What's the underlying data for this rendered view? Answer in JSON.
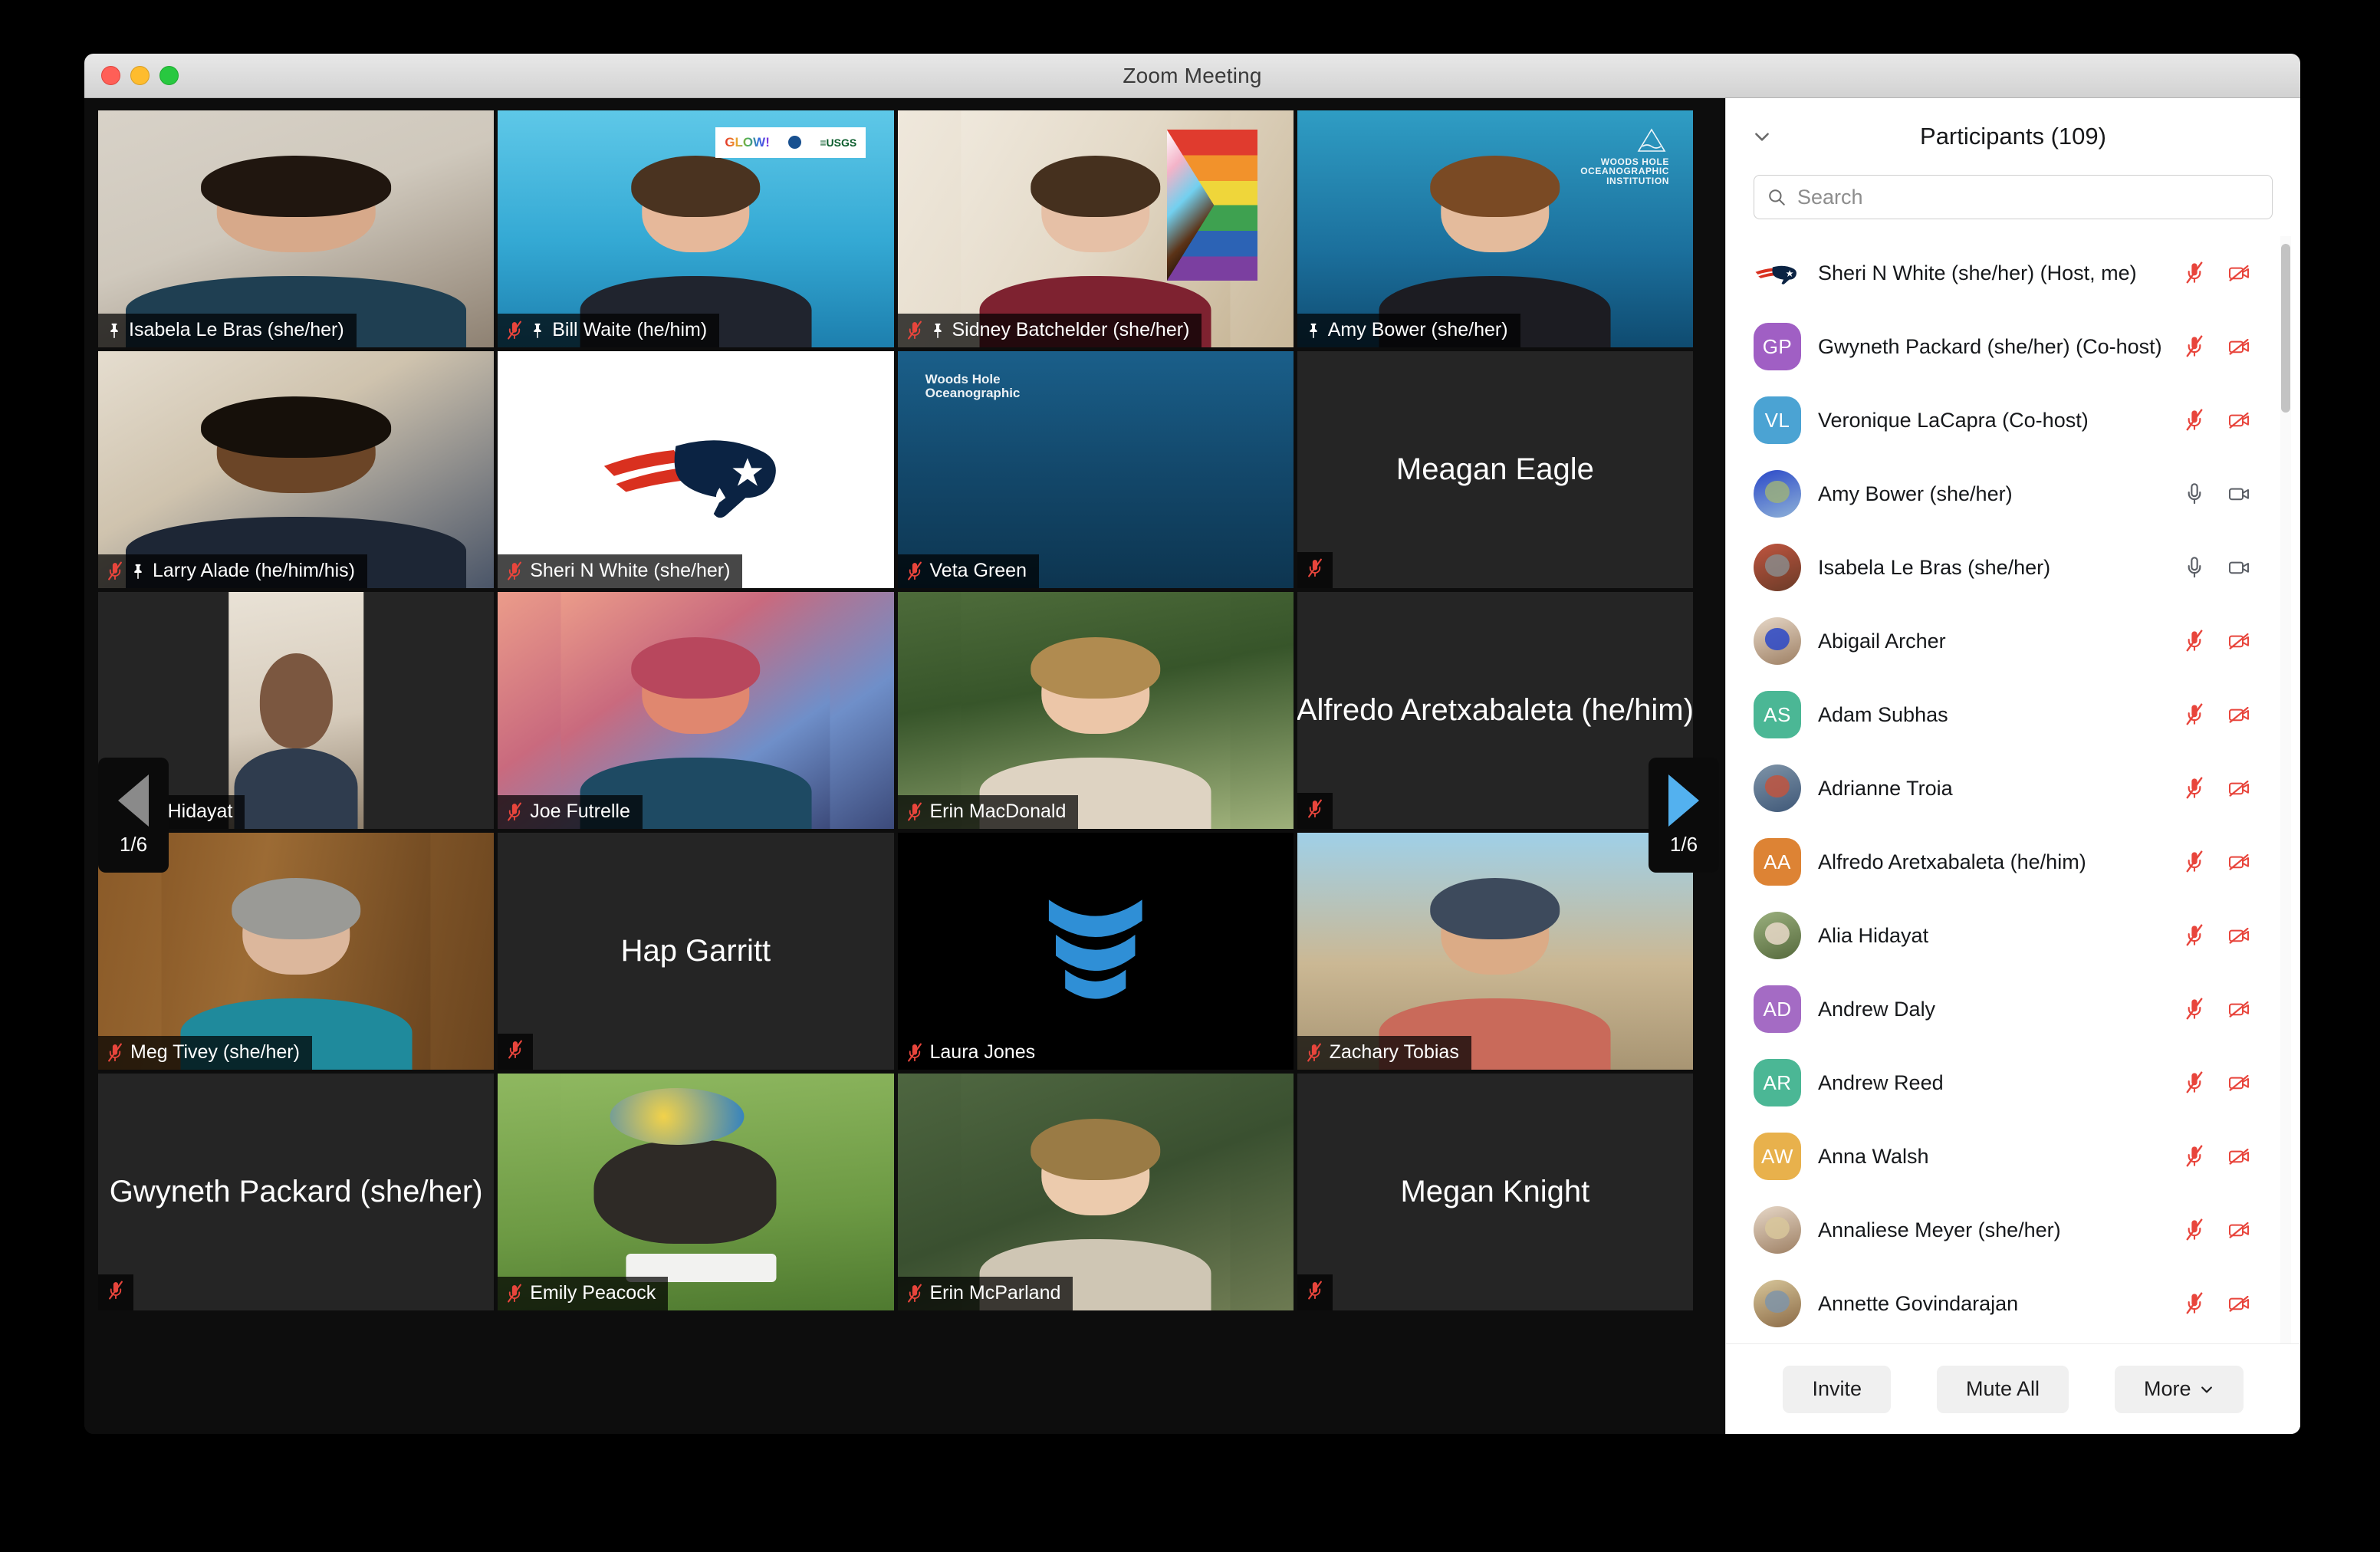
{
  "window": {
    "title": "Zoom Meeting",
    "traffic_lights": [
      "close-button",
      "minimize-button",
      "maximize-button"
    ]
  },
  "video_grid": {
    "page_indicator": "1/6",
    "prev_arrow_label": "1/6",
    "next_arrow_label": "1/6",
    "tiles": [
      {
        "name": "Isabela Le Bras (she/her)",
        "display": "video",
        "active_speaker": true,
        "pinned": true,
        "muted": false,
        "bg": "bg-room1",
        "label_mode": "bottom"
      },
      {
        "name": "Bill Waite (he/him)",
        "display": "video",
        "active_speaker": false,
        "pinned": true,
        "muted": true,
        "bg": "bg-ocean-light",
        "label_mode": "bottom",
        "overlay": "glow-usgs"
      },
      {
        "name": "Sidney Batchelder (she/her)",
        "display": "video",
        "active_speaker": false,
        "pinned": true,
        "muted": true,
        "bg": "bg-room-wall",
        "label_mode": "bottom",
        "overlay": "pride-flag"
      },
      {
        "name": "Amy Bower (she/her)",
        "display": "video",
        "active_speaker": false,
        "pinned": true,
        "muted": false,
        "bg": "bg-ocean-mid",
        "label_mode": "bottom",
        "overlay": "whoi"
      },
      {
        "name": "Larry Alade (he/him/his)",
        "display": "video",
        "active_speaker": false,
        "pinned": true,
        "muted": true,
        "bg": "bg-living",
        "label_mode": "bottom"
      },
      {
        "name": "Sheri N White (she/her)",
        "display": "avatar",
        "active_speaker": false,
        "pinned": false,
        "muted": true,
        "bg": "bg-white",
        "label_mode": "bottom",
        "overlay": "patriots"
      },
      {
        "name": "Veta Green",
        "display": "video",
        "active_speaker": false,
        "pinned": false,
        "muted": true,
        "bg": "bg-ocean-deep",
        "label_mode": "bottom",
        "overlay": "whoi-text"
      },
      {
        "name": "Meagan Eagle",
        "display": "name",
        "active_speaker": false,
        "pinned": false,
        "muted": true,
        "bg": "bg-dark",
        "label_mode": "center"
      },
      {
        "name": "Alia Hidayat",
        "display": "avatar",
        "active_speaker": false,
        "pinned": false,
        "muted": true,
        "bg": "bg-dark",
        "label_mode": "bottom",
        "overlay": "portrait-alia"
      },
      {
        "name": "Joe Futrelle",
        "display": "avatar",
        "active_speaker": false,
        "pinned": false,
        "muted": true,
        "bg": "bg-art",
        "label_mode": "bottom"
      },
      {
        "name": "Erin MacDonald",
        "display": "avatar",
        "active_speaker": false,
        "pinned": false,
        "muted": true,
        "bg": "bg-garden",
        "label_mode": "bottom"
      },
      {
        "name": "Alfredo Aretxabaleta (he/him)",
        "display": "name",
        "active_speaker": false,
        "pinned": false,
        "muted": true,
        "bg": "bg-dark",
        "label_mode": "center"
      },
      {
        "name": "Meg Tivey (she/her)",
        "display": "video",
        "active_speaker": false,
        "pinned": false,
        "muted": true,
        "bg": "bg-wood",
        "label_mode": "bottom"
      },
      {
        "name": "Hap Garritt",
        "display": "name",
        "active_speaker": false,
        "pinned": false,
        "muted": true,
        "bg": "bg-dark",
        "label_mode": "center"
      },
      {
        "name": "Laura Jones",
        "display": "avatar",
        "active_speaker": false,
        "pinned": false,
        "muted": true,
        "bg": "bg-laurajones",
        "label_mode": "bottom",
        "overlay": "jones-logo"
      },
      {
        "name": "Zachary Tobias",
        "display": "avatar",
        "active_speaker": false,
        "pinned": false,
        "muted": true,
        "bg": "bg-beach",
        "label_mode": "bottom"
      },
      {
        "name": "Gwyneth Packard (she/her)",
        "display": "name",
        "active_speaker": false,
        "pinned": false,
        "muted": true,
        "bg": "bg-dark",
        "label_mode": "center"
      },
      {
        "name": "Emily Peacock",
        "display": "avatar",
        "active_speaker": false,
        "pinned": false,
        "muted": true,
        "bg": "bg-dog",
        "label_mode": "bottom"
      },
      {
        "name": "Erin McParland",
        "display": "avatar",
        "active_speaker": false,
        "pinned": false,
        "muted": true,
        "bg": "bg-curly",
        "label_mode": "bottom"
      },
      {
        "name": "Megan Knight",
        "display": "name",
        "active_speaker": false,
        "pinned": false,
        "muted": true,
        "bg": "bg-dark",
        "label_mode": "center"
      }
    ]
  },
  "participants_panel": {
    "title": "Participants (109)",
    "count": 109,
    "search": {
      "placeholder": "Search",
      "value": ""
    },
    "collapse_icon": "chevron-down-icon",
    "rows": [
      {
        "name": "Sheri N White (she/her) (Host, me)",
        "avatar_type": "image",
        "avatar_initials": "",
        "avatar_color": "#ffffff",
        "mic": "muted",
        "cam": "off"
      },
      {
        "name": "Gwyneth Packard (she/her) (Co-host)",
        "avatar_type": "initials",
        "avatar_initials": "GP",
        "avatar_color": "#a05fc4",
        "mic": "muted",
        "cam": "off"
      },
      {
        "name": "Veronique LaCapra (Co-host)",
        "avatar_type": "initials",
        "avatar_initials": "VL",
        "avatar_color": "#4ba3d3",
        "mic": "muted",
        "cam": "off"
      },
      {
        "name": "Amy Bower (she/her)",
        "avatar_type": "image",
        "avatar_initials": "",
        "avatar_color": "#9bb07e",
        "mic": "unmuted",
        "cam": "on"
      },
      {
        "name": "Isabela Le Bras (she/her)",
        "avatar_type": "image",
        "avatar_initials": "",
        "avatar_color": "#8a8a8a",
        "mic": "unmuted",
        "cam": "on"
      },
      {
        "name": "Abigail Archer",
        "avatar_type": "image",
        "avatar_initials": "",
        "avatar_color": "#2a48c8",
        "mic": "muted",
        "cam": "off"
      },
      {
        "name": "Adam Subhas",
        "avatar_type": "initials",
        "avatar_initials": "AS",
        "avatar_color": "#4bb795",
        "mic": "muted",
        "cam": "off"
      },
      {
        "name": "Adrianne Troia",
        "avatar_type": "image",
        "avatar_initials": "",
        "avatar_color": "#c0553f",
        "mic": "muted",
        "cam": "off"
      },
      {
        "name": "Alfredo Aretxabaleta (he/him)",
        "avatar_type": "initials",
        "avatar_initials": "AA",
        "avatar_color": "#dd8334",
        "mic": "muted",
        "cam": "off"
      },
      {
        "name": "Alia Hidayat",
        "avatar_type": "image",
        "avatar_initials": "",
        "avatar_color": "#e7d8c8",
        "mic": "muted",
        "cam": "off"
      },
      {
        "name": "Andrew Daly",
        "avatar_type": "initials",
        "avatar_initials": "AD",
        "avatar_color": "#a46bc4",
        "mic": "muted",
        "cam": "off"
      },
      {
        "name": "Andrew Reed",
        "avatar_type": "initials",
        "avatar_initials": "AR",
        "avatar_color": "#4bb795",
        "mic": "muted",
        "cam": "off"
      },
      {
        "name": "Anna Walsh",
        "avatar_type": "initials",
        "avatar_initials": "AW",
        "avatar_color": "#e8b14c",
        "mic": "muted",
        "cam": "off"
      },
      {
        "name": "Annaliese Meyer (she/her)",
        "avatar_type": "image",
        "avatar_initials": "",
        "avatar_color": "#d8c79b",
        "mic": "muted",
        "cam": "off"
      },
      {
        "name": "Annette Govindarajan",
        "avatar_type": "image",
        "avatar_initials": "",
        "avatar_color": "#7f94a8",
        "mic": "muted",
        "cam": "off"
      },
      {
        "name": "",
        "avatar_type": "image",
        "avatar_initials": "",
        "avatar_color": "#3f5878",
        "mic": "muted",
        "cam": "off"
      }
    ],
    "footer": {
      "invite_label": "Invite",
      "mute_all_label": "Mute All",
      "more_label": "More"
    }
  },
  "colors": {
    "active_speaker_border": "#c7e06a",
    "muted_red": "#e8453c",
    "next_arrow_blue": "#53b1ef",
    "prev_arrow_gray": "#8a8a8a"
  }
}
